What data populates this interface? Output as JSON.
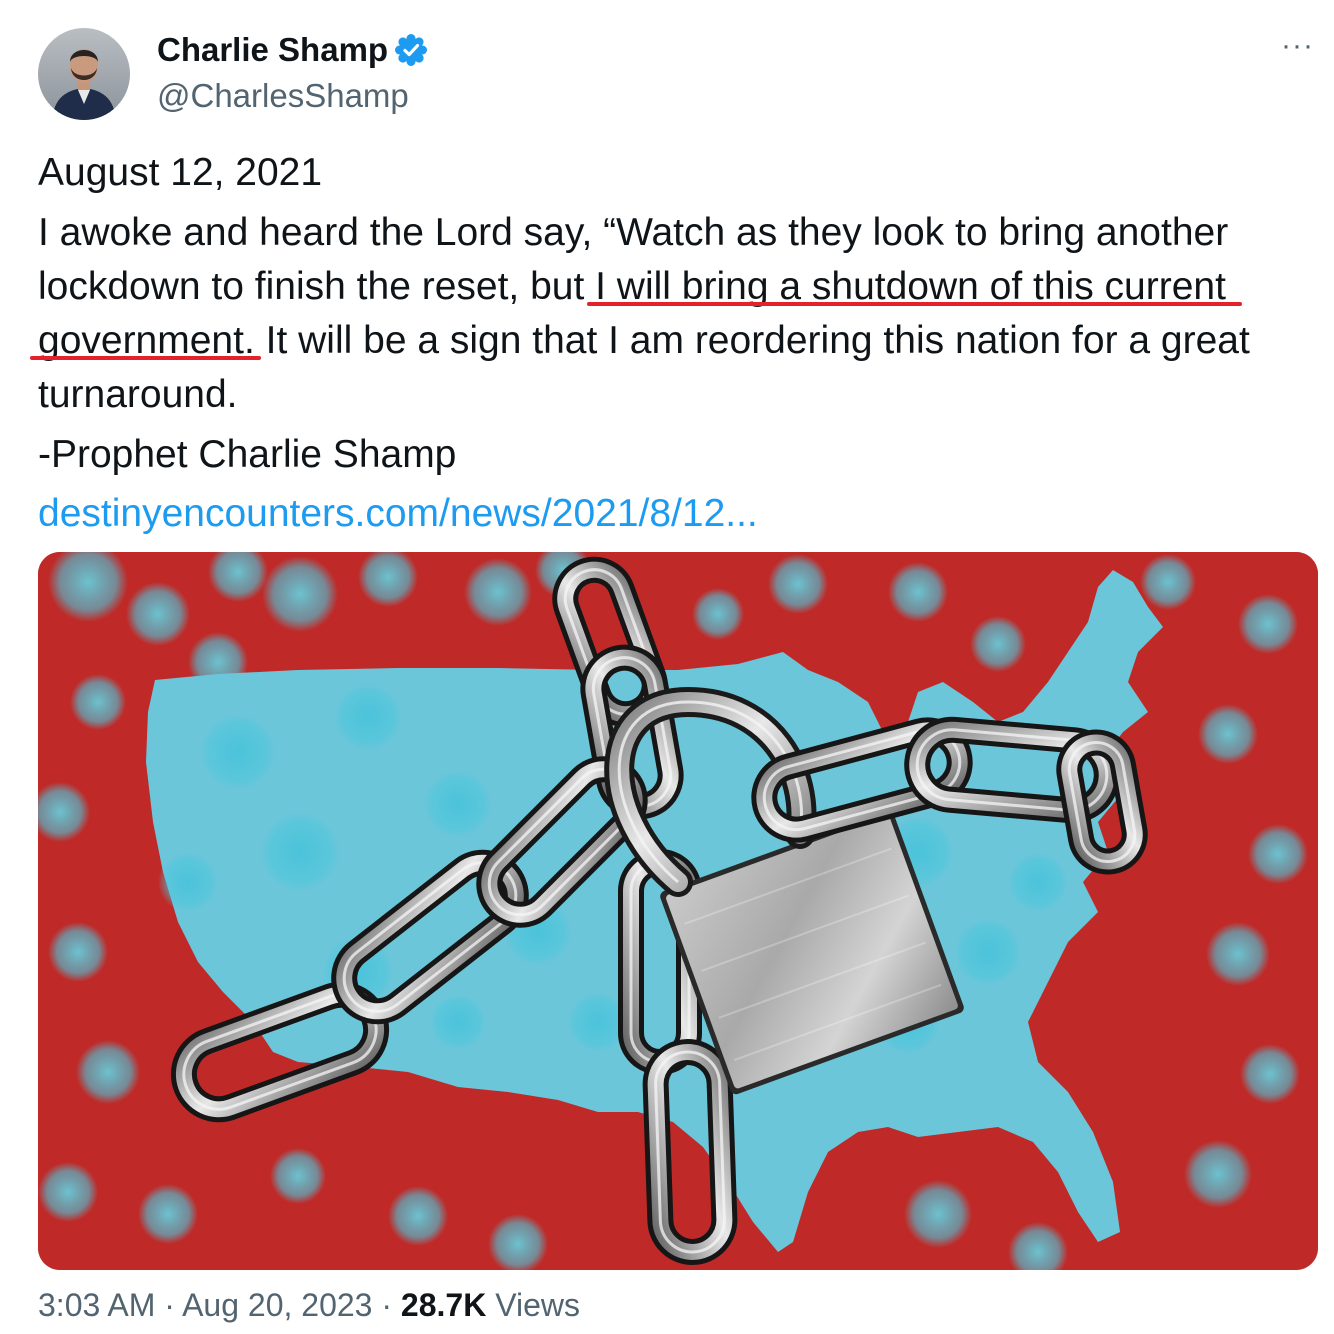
{
  "author": {
    "name": "Charlie Shamp",
    "handle": "@CharlesShamp",
    "avatar_icon": "profile-avatar",
    "verified_icon": "verified-badge-icon"
  },
  "more_label": "···",
  "tweet": {
    "date_line": "August 12, 2021",
    "line1": "I awoke and heard the Lord say, “Watch as they look to bring another",
    "line2_pre": "lockdown to finish the reset, but ",
    "line2_highlight": "I will bring a shutdown of this current",
    "line3_highlight": "government.",
    "line3_post": " It will be a sign that I am reordering this nation for a great",
    "line4": "turnaround.",
    "signature": "-Prophet Charlie Shamp",
    "link": "destinyencounters.com/news/2021/8/12..."
  },
  "meta": {
    "time": "3:03 AM",
    "sep1": " · ",
    "date": "Aug 20, 2023",
    "sep2": " · ",
    "views_count": "28.7K",
    "views_label": " Views"
  },
  "colors": {
    "accent": "#1d9bf0",
    "underline": "#e2232a",
    "image_red": "#bf2a28",
    "image_cyan": "#6cc6da"
  }
}
